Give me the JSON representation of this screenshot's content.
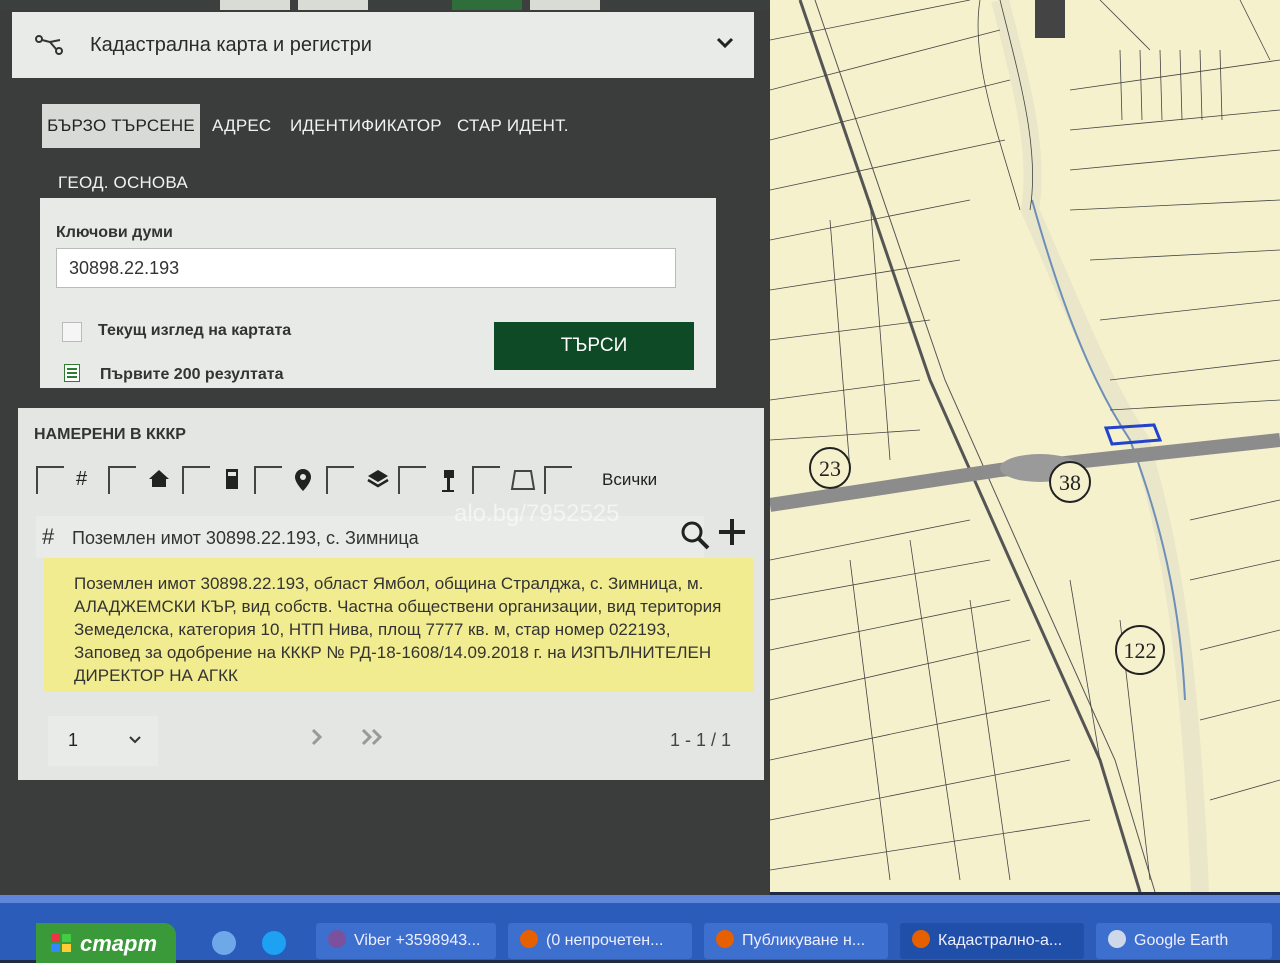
{
  "header": {
    "title": "Кадастрална карта и регистри"
  },
  "tabs": [
    {
      "label": "БЪРЗО ТЪРСЕНЕ"
    },
    {
      "label": "АДРЕС"
    },
    {
      "label": "ИДЕНТИФИКАТОР"
    },
    {
      "label": "СТАР ИДЕНТ."
    },
    {
      "label": "ГЕОД. ОСНОВА"
    }
  ],
  "search": {
    "keywords_label": "Ключови думи",
    "keywords_value": "30898.22.193",
    "current_view_label": "Текущ изглед на картата",
    "first200_label": "Първите 200 резултата",
    "search_button": "ТЪРСИ"
  },
  "results": {
    "title": "НАМЕРЕНИ В КККР",
    "all_label": "Всички",
    "item_title": "Поземлен имот 30898.22.193, с. Зимница",
    "watermark": "alo.bg/7952525",
    "description_lines": [
      "Поземлен имот 30898.22.193, област Ямбол, община Стралджа, с. Зимница, м.",
      "АЛАДЖЕМСКИ КЪР, вид собств. Частна обществени организации, вид територия",
      "Земеделска, категория 10, НТП Нива, площ 7777 кв. м, стар номер 022193,",
      "Заповед за одобрение на КККР № РД-18-1608/14.09.2018 г. на ИЗПЪЛНИТЕЛЕН",
      "ДИРЕКТОР НА АГКК"
    ],
    "page_value": "1",
    "count": "1 - 1 / 1"
  },
  "map": {
    "labels": [
      "23",
      "38",
      "122"
    ]
  },
  "taskbar": {
    "start": "старт",
    "items": [
      {
        "label": "Viber +3598943..."
      },
      {
        "label": "(0 непрочетен..."
      },
      {
        "label": "Публикуване н..."
      },
      {
        "label": "Кадастрално-а..."
      },
      {
        "label": "Google Earth"
      }
    ]
  },
  "colors": {
    "panel_bg": "#3a3d3c",
    "search_button": "#0f4a26",
    "result_highlight": "#f1ec8f",
    "map_bg": "#f5f1cd",
    "taskbar": "#2b5cba",
    "start_button": "#3a9a3a"
  }
}
